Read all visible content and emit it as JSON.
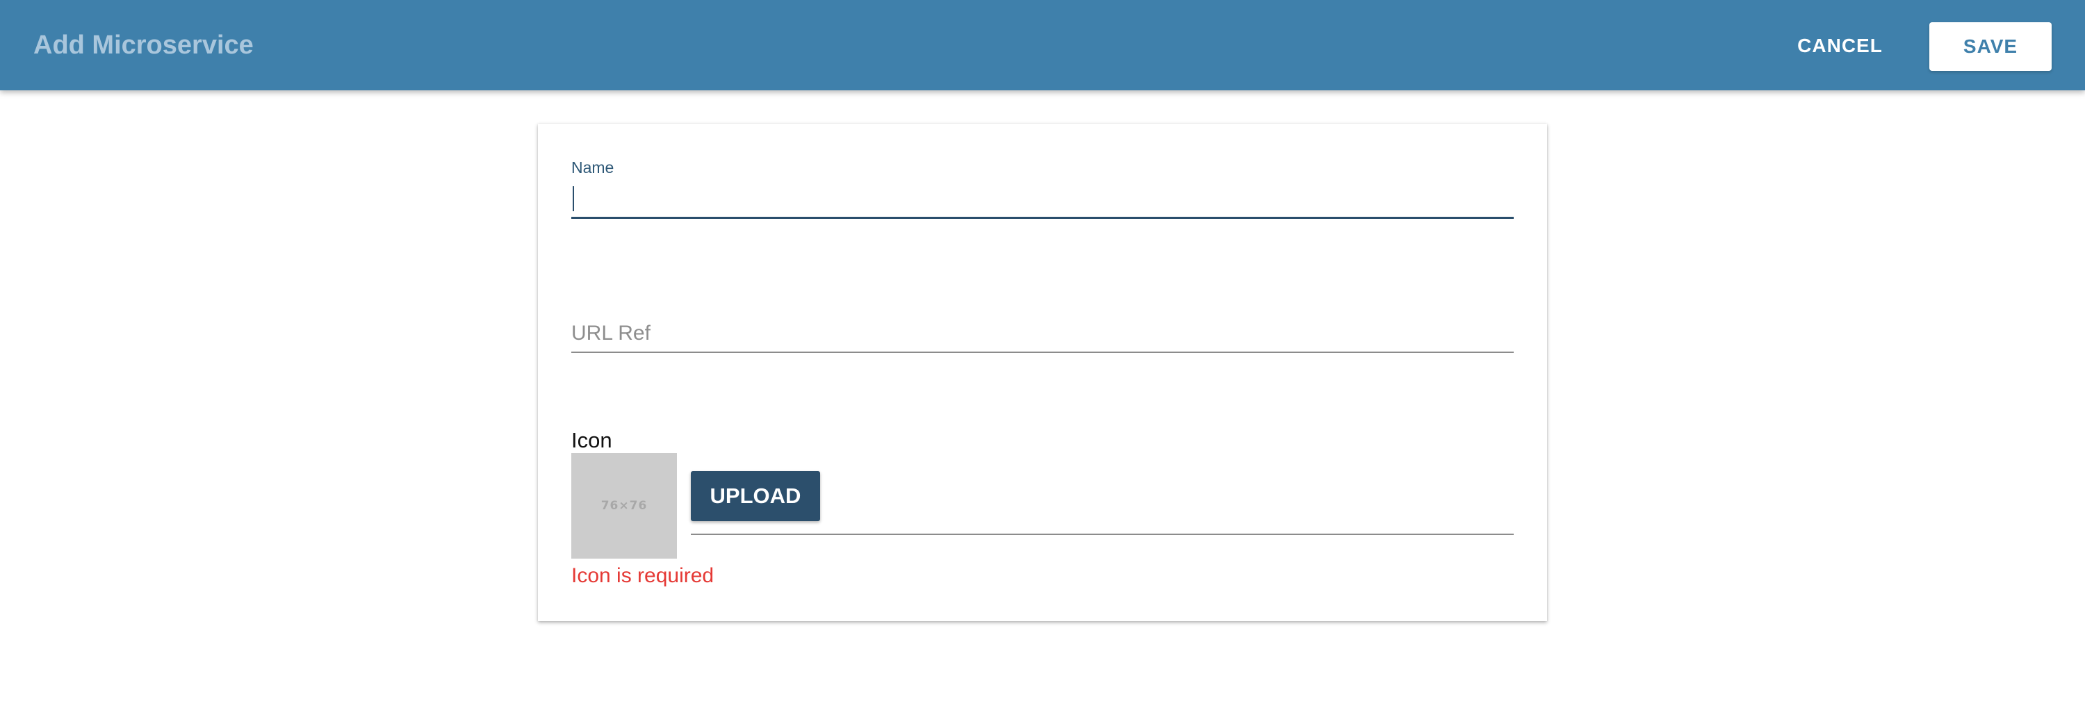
{
  "header": {
    "title": "Add Microservice",
    "cancel_label": "CANCEL",
    "save_label": "SAVE",
    "background_color": "#3f80ab"
  },
  "form": {
    "name": {
      "label": "Name",
      "value": ""
    },
    "url_ref": {
      "placeholder": "URL Ref",
      "value": ""
    },
    "icon": {
      "label": "Icon",
      "preview_text": "76×76",
      "upload_label": "UPLOAD",
      "error": "Icon is required"
    }
  },
  "colors": {
    "primary": "#2c4f6c",
    "error": "#e53935"
  }
}
